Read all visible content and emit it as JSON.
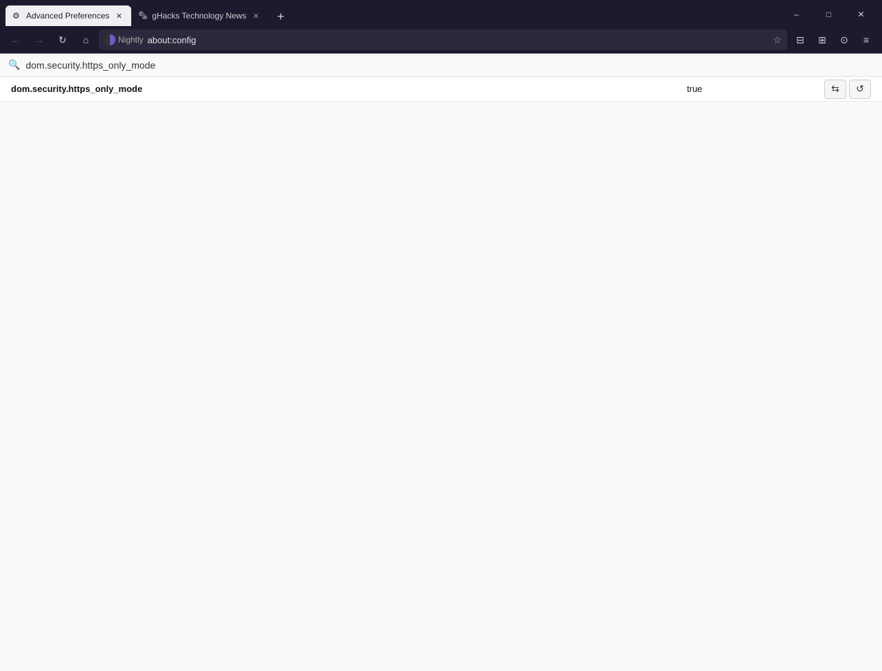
{
  "browser": {
    "tabs": [
      {
        "id": "tab-advanced-prefs",
        "title": "Advanced Preferences",
        "favicon": "gear",
        "active": true,
        "url": "about:config"
      },
      {
        "id": "tab-ghacks",
        "title": "gHacks Technology News",
        "favicon": "news",
        "active": false,
        "url": "https://www.ghacks.net"
      }
    ],
    "new_tab_label": "+",
    "window_controls": {
      "minimize": "–",
      "maximize": "□",
      "close": "✕"
    }
  },
  "navbar": {
    "back_title": "Back",
    "forward_title": "Forward",
    "reload_title": "Reload",
    "home_title": "Home",
    "nightly_label": "Nightly",
    "address": "about:config",
    "star_icon": "☆"
  },
  "toolbar": {
    "bookmarks_icon": "⊟",
    "sidebar_icon": "⊞",
    "account_icon": "⊙",
    "menu_icon": "≡"
  },
  "page": {
    "search": {
      "placeholder": "dom.security.https_only_mode",
      "value": "dom.security.https_only_mode"
    },
    "preferences": [
      {
        "name": "dom.security.https_only_mode",
        "value": "true",
        "toggle_icon": "⇆",
        "reset_icon": "↺"
      }
    ]
  }
}
